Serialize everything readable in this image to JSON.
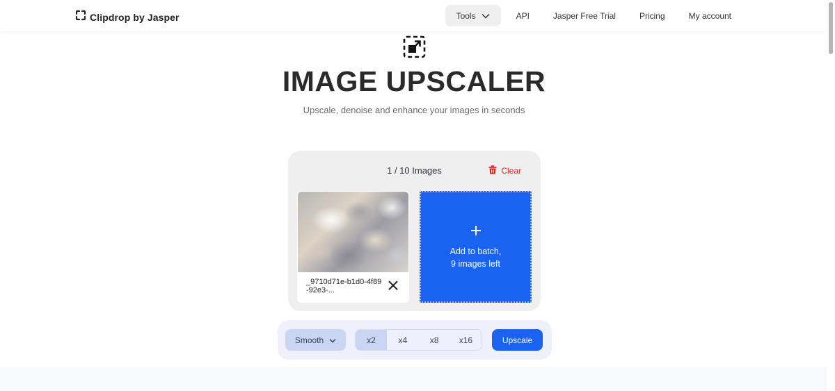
{
  "header": {
    "logo_icon": "clipdrop-bracket-icon",
    "logo_text": "Clipdrop by Jasper",
    "nav": [
      {
        "label": "Tools",
        "icon": "chevron-down-icon"
      },
      {
        "label": "API"
      },
      {
        "label": "Jasper Free Trial"
      },
      {
        "label": "Pricing"
      },
      {
        "label": "My account"
      }
    ]
  },
  "hero": {
    "icon": "upscale-icon",
    "title": "IMAGE UPSCALER",
    "subtitle": "Upscale, denoise and enhance your images in seconds"
  },
  "batch": {
    "count_text": "1 / 10 Images",
    "clear_label": "Clear",
    "clear_icon": "trash-icon",
    "items": [
      {
        "filename": "_9710d71e-b1d0-4f89-92e3-...",
        "remove_icon": "close-icon"
      }
    ],
    "add": {
      "icon": "plus-icon",
      "line1": "Add to batch,",
      "line2": "9 images left"
    }
  },
  "toolbar": {
    "mode_selected": "Smooth",
    "mode_icon": "chevron-down-icon",
    "scales": [
      "x2",
      "x4",
      "x8",
      "x16"
    ],
    "scale_selected": "x2",
    "upscale_label": "Upscale"
  },
  "colors": {
    "accent": "#1a62f0",
    "danger": "#dc2626",
    "toolbar_bg": "#eef1fb",
    "selected_bg": "#c9d5f3"
  }
}
